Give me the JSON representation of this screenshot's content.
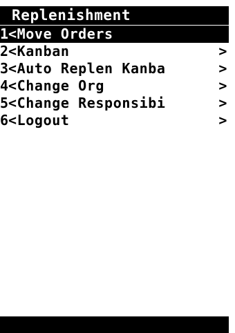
{
  "app": {
    "title": "Replenishment"
  },
  "menu": {
    "items": [
      {
        "number": "1",
        "label": "<Move Orders",
        "arrow": "",
        "selected": true
      },
      {
        "number": "2",
        "label": "<Kanban",
        "arrow": ">",
        "selected": false
      },
      {
        "number": "3",
        "label": "<Auto Replen Kanba",
        "arrow": ">",
        "selected": false
      },
      {
        "number": "4",
        "label": "<Change Org",
        "arrow": ">",
        "selected": false
      },
      {
        "number": "5",
        "label": "<Change Responsibi",
        "arrow": ">",
        "selected": false
      },
      {
        "number": "6",
        "label": "<Logout",
        "arrow": ">",
        "selected": false
      }
    ]
  },
  "colors": {
    "background": "#ffffff",
    "foreground": "#000000",
    "highlight_bg": "#000000",
    "highlight_fg": "#ffffff"
  }
}
